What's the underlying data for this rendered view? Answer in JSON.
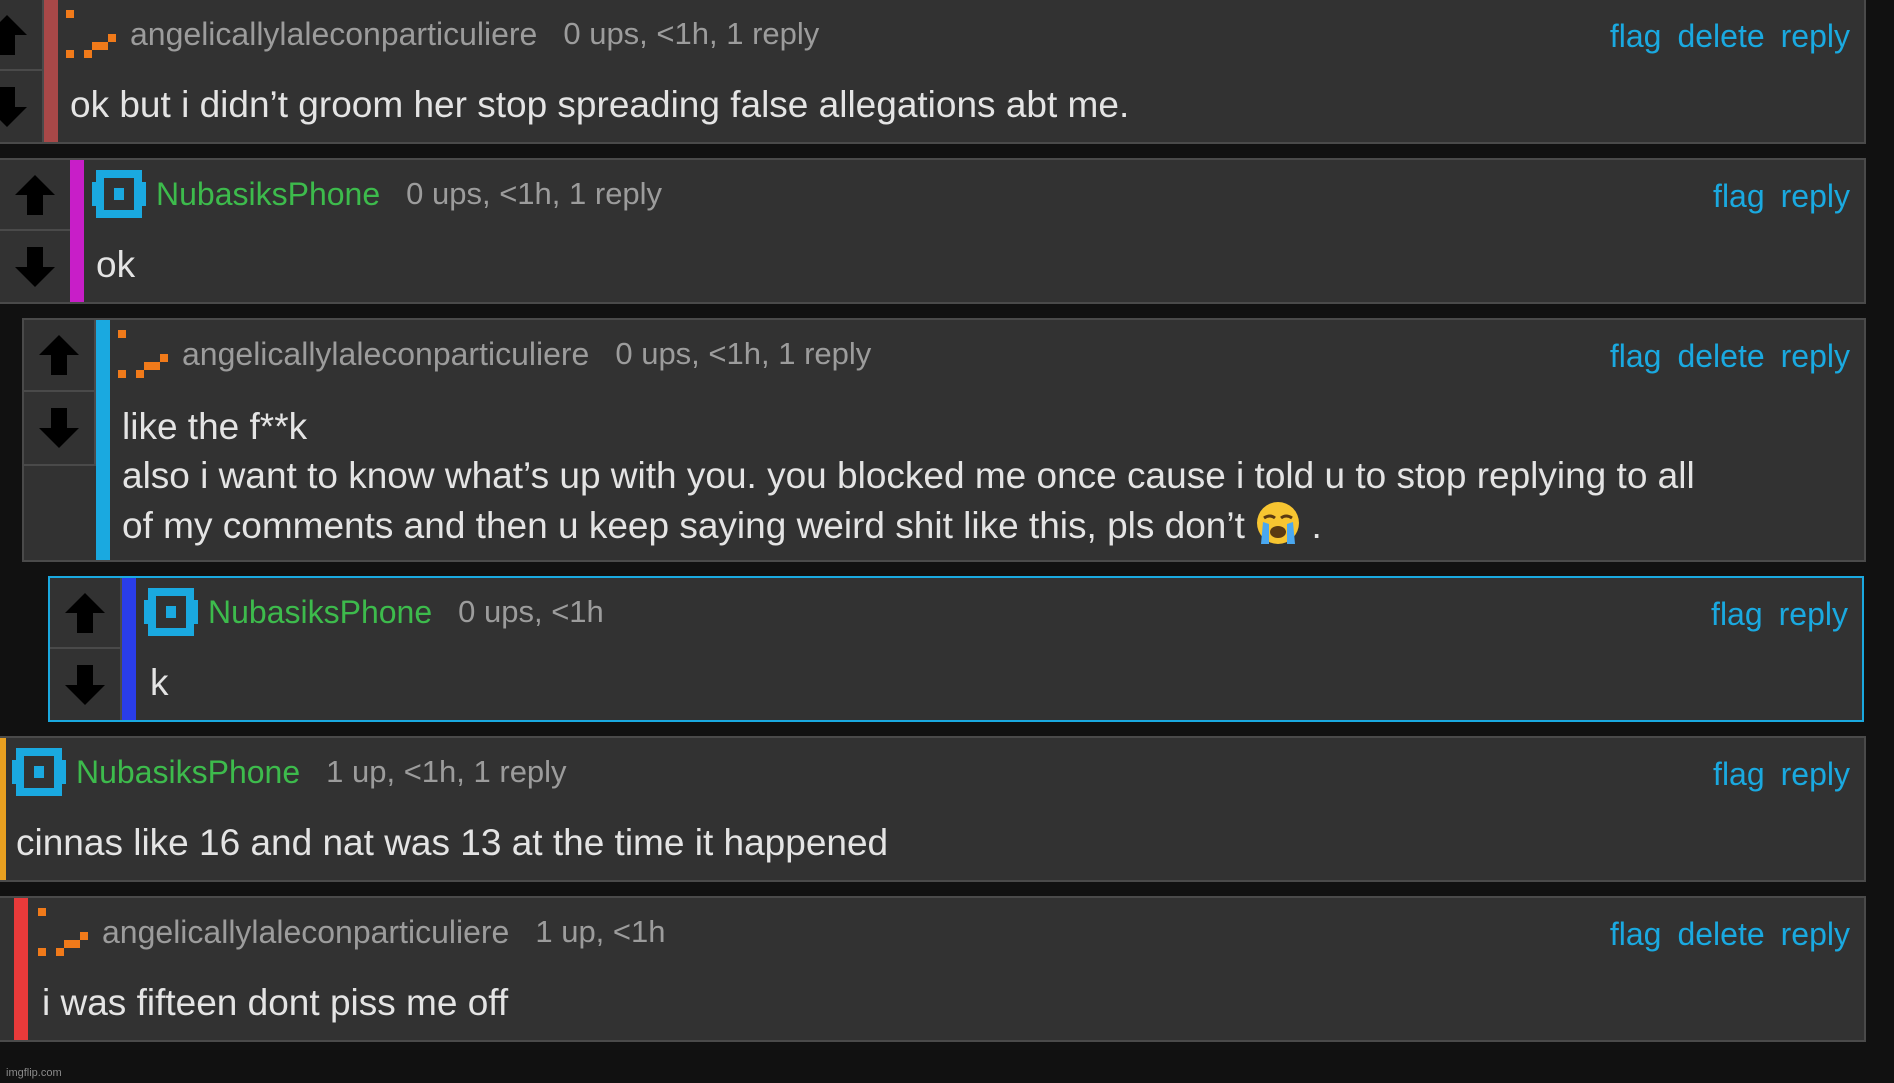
{
  "comments": [
    {
      "username": "angelicallylaleconparticuliere",
      "meta": "0 ups, <1h, 1 reply",
      "actions": {
        "flag": "flag",
        "delete": "delete",
        "reply": "reply"
      },
      "text": "ok but i didn’t groom her stop spreading false allegations abt me.",
      "bar_color": "#a84848",
      "avatar": "orange-stairs-avatar-icon"
    },
    {
      "username": "NubasiksPhone",
      "meta": "0 ups, <1h, 1 reply",
      "actions": {
        "flag": "flag",
        "reply": "reply"
      },
      "text": "ok",
      "bar_color": "#c81ec8",
      "avatar": "blue-square-avatar-icon"
    },
    {
      "username": "angelicallylaleconparticuliere",
      "meta": "0 ups, <1h, 1 reply",
      "actions": {
        "flag": "flag",
        "delete": "delete",
        "reply": "reply"
      },
      "text_line1": "like the f**k",
      "text_line2": "also i want to know what’s up with you. you blocked me once cause i told u to stop replying to all",
      "text_line3": "of my comments and then u keep saying weird shit like this, pls don’t",
      "text_line3_end": " .",
      "emoji": "loudly-crying-face-icon",
      "bar_color": "#1aa9e0",
      "avatar": "orange-stairs-avatar-icon"
    },
    {
      "username": "NubasiksPhone",
      "meta": "0 ups, <1h",
      "actions": {
        "flag": "flag",
        "reply": "reply"
      },
      "text": "k",
      "bar_color": "#2a3de8",
      "avatar": "blue-square-avatar-icon"
    },
    {
      "username": "NubasiksPhone",
      "meta": "1 up, <1h, 1 reply",
      "actions": {
        "flag": "flag",
        "reply": "reply"
      },
      "text": "cinnas like 16 and nat was 13 at the time it happened",
      "bar_color": "#e8a020",
      "avatar": "blue-square-avatar-icon"
    },
    {
      "username": "angelicallylaleconparticuliere",
      "meta": "1 up, <1h",
      "actions": {
        "flag": "flag",
        "delete": "delete",
        "reply": "reply"
      },
      "text": "i was fifteen dont piss me off",
      "bar_color": "#e83a3a",
      "avatar": "orange-stairs-avatar-icon"
    }
  ],
  "watermark": "imgflip.com",
  "colors": {
    "background": "#111111",
    "panel": "#323232",
    "link": "#1aa9e0",
    "username_green": "#3dbb4c",
    "text": "#e4e4e4"
  }
}
